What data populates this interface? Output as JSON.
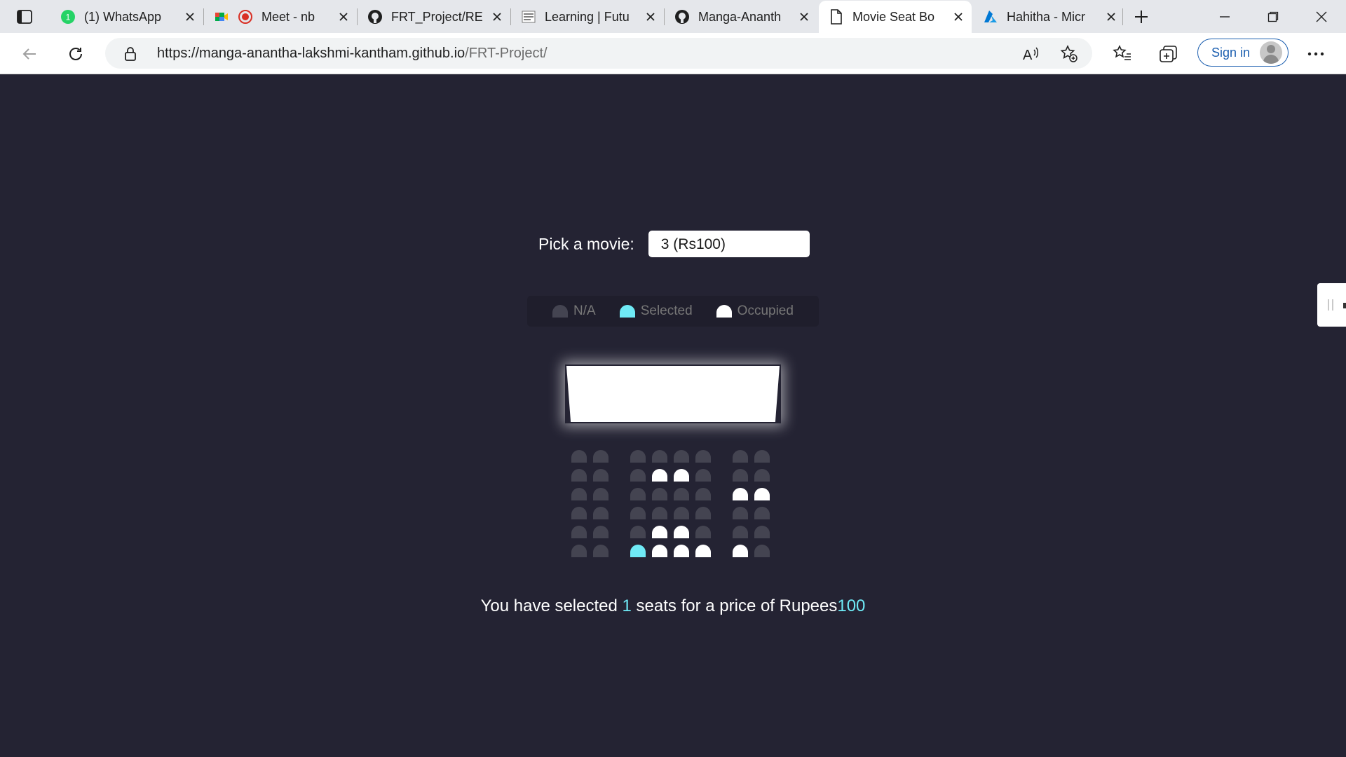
{
  "browser": {
    "tabs": [
      {
        "title": "(1) WhatsApp",
        "icon": "whatsapp-icon"
      },
      {
        "title": "Meet - nb",
        "icon": "google-meet-icon"
      },
      {
        "title": "FRT_Project/RE",
        "icon": "github-icon"
      },
      {
        "title": "Learning | Futu",
        "icon": "learning-site-icon"
      },
      {
        "title": "Manga-Ananth",
        "icon": "github-icon"
      },
      {
        "title": "Movie Seat Bo",
        "icon": "page-icon"
      },
      {
        "title": "Hahitha - Micr",
        "icon": "azure-icon"
      }
    ],
    "active_tab": 5,
    "url_host": "https://manga-anantha-lakshmi-kantham.github.io",
    "url_path": "/FRT-Project/",
    "signin_label": "Sign in",
    "accent_color": "#1c5fb0"
  },
  "page": {
    "picker_label": "Pick a movie:",
    "selected_movie": "3 (Rs100)",
    "legend": {
      "na": "N/A",
      "selected": "Selected",
      "occupied": "Occupied"
    },
    "colors": {
      "background": "#242333",
      "seat": "#444451",
      "selected": "#6feaf6",
      "occupied": "#ffffff"
    },
    "seat_rows": [
      [
        "n",
        "n",
        "n",
        "n",
        "n",
        "n",
        "n",
        "n"
      ],
      [
        "n",
        "n",
        "n",
        "o",
        "o",
        "n",
        "n",
        "n"
      ],
      [
        "n",
        "n",
        "n",
        "n",
        "n",
        "n",
        "o",
        "o"
      ],
      [
        "n",
        "n",
        "n",
        "n",
        "n",
        "n",
        "n",
        "n"
      ],
      [
        "n",
        "n",
        "n",
        "o",
        "o",
        "n",
        "n",
        "n"
      ],
      [
        "n",
        "n",
        "s",
        "o",
        "o",
        "o",
        "o",
        "n"
      ]
    ],
    "summary": {
      "prefix": "You have selected ",
      "count": "1",
      "middle": " seats for a price of Rupees",
      "price": "100"
    }
  }
}
